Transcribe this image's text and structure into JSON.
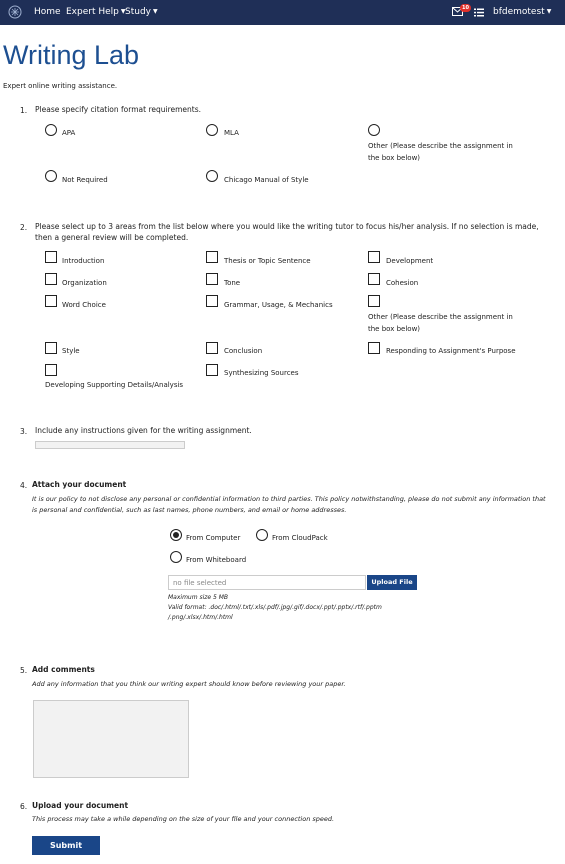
{
  "nav": {
    "home": "Home",
    "expert_help": "Expert Help",
    "study": "Study",
    "badge_count": "10",
    "user": "bfdemotest"
  },
  "page": {
    "title": "Writing Lab",
    "subtitle": "Expert online writing assistance."
  },
  "q1": {
    "num": "1.",
    "text": "Please specify citation format requirements.",
    "options": [
      "APA",
      "MLA",
      "Other (Please describe the assignment in the box below)",
      "Not Required",
      "Chicago Manual of Style"
    ]
  },
  "q2": {
    "num": "2.",
    "text": "Please select up to 3 areas from the list below where you would like the writing tutor to focus his/her analysis. If no selection is made, then a general review will be completed.",
    "options": [
      "Introduction",
      "Thesis or Topic Sentence",
      "Development",
      "Organization",
      "Tone",
      "Cohesion",
      "Word Choice",
      "Grammar, Usage, & Mechanics",
      "Other (Please describe the assignment in the box below)",
      "Style",
      "Conclusion",
      "Responding to Assignment's Purpose",
      "Developing Supporting Details/Analysis",
      "Synthesizing Sources"
    ]
  },
  "q3": {
    "num": "3.",
    "text": "Include any instructions given for the writing assignment."
  },
  "q4": {
    "num": "4.",
    "text": "Attach your document",
    "note": "It is our policy to not disclose any personal or confidential information to third parties. This policy notwithstanding, please do not submit any information that is personal and confidential, such as last names, phone numbers, and email or home addresses.",
    "from_computer": "From Computer",
    "from_cloudpack": "From CloudPack",
    "from_whiteboard": "From Whiteboard",
    "file_placeholder": "no file selected",
    "upload_label": "Upload File",
    "max_size": "Maximum size 5 MB",
    "valid_formats": "Valid format: .doc/.html/.txt/.xls/.pdf/.jpg/.gif/.docx/.ppt/.pptx/.rtf/.pptm /.png/.xlsx/.htm/.html"
  },
  "q5": {
    "num": "5.",
    "text": "Add comments",
    "note": "Add any information that you think our writing expert should know before reviewing your paper."
  },
  "q6": {
    "num": "6.",
    "text": "Upload your document",
    "note": "This process may take a while depending on the size of your file and your connection speed."
  },
  "submit_label": "Submit",
  "colors": {
    "navbar": "#1f2f57",
    "title": "#1d4f91",
    "button": "#1a4688",
    "badge": "#e0302b"
  }
}
